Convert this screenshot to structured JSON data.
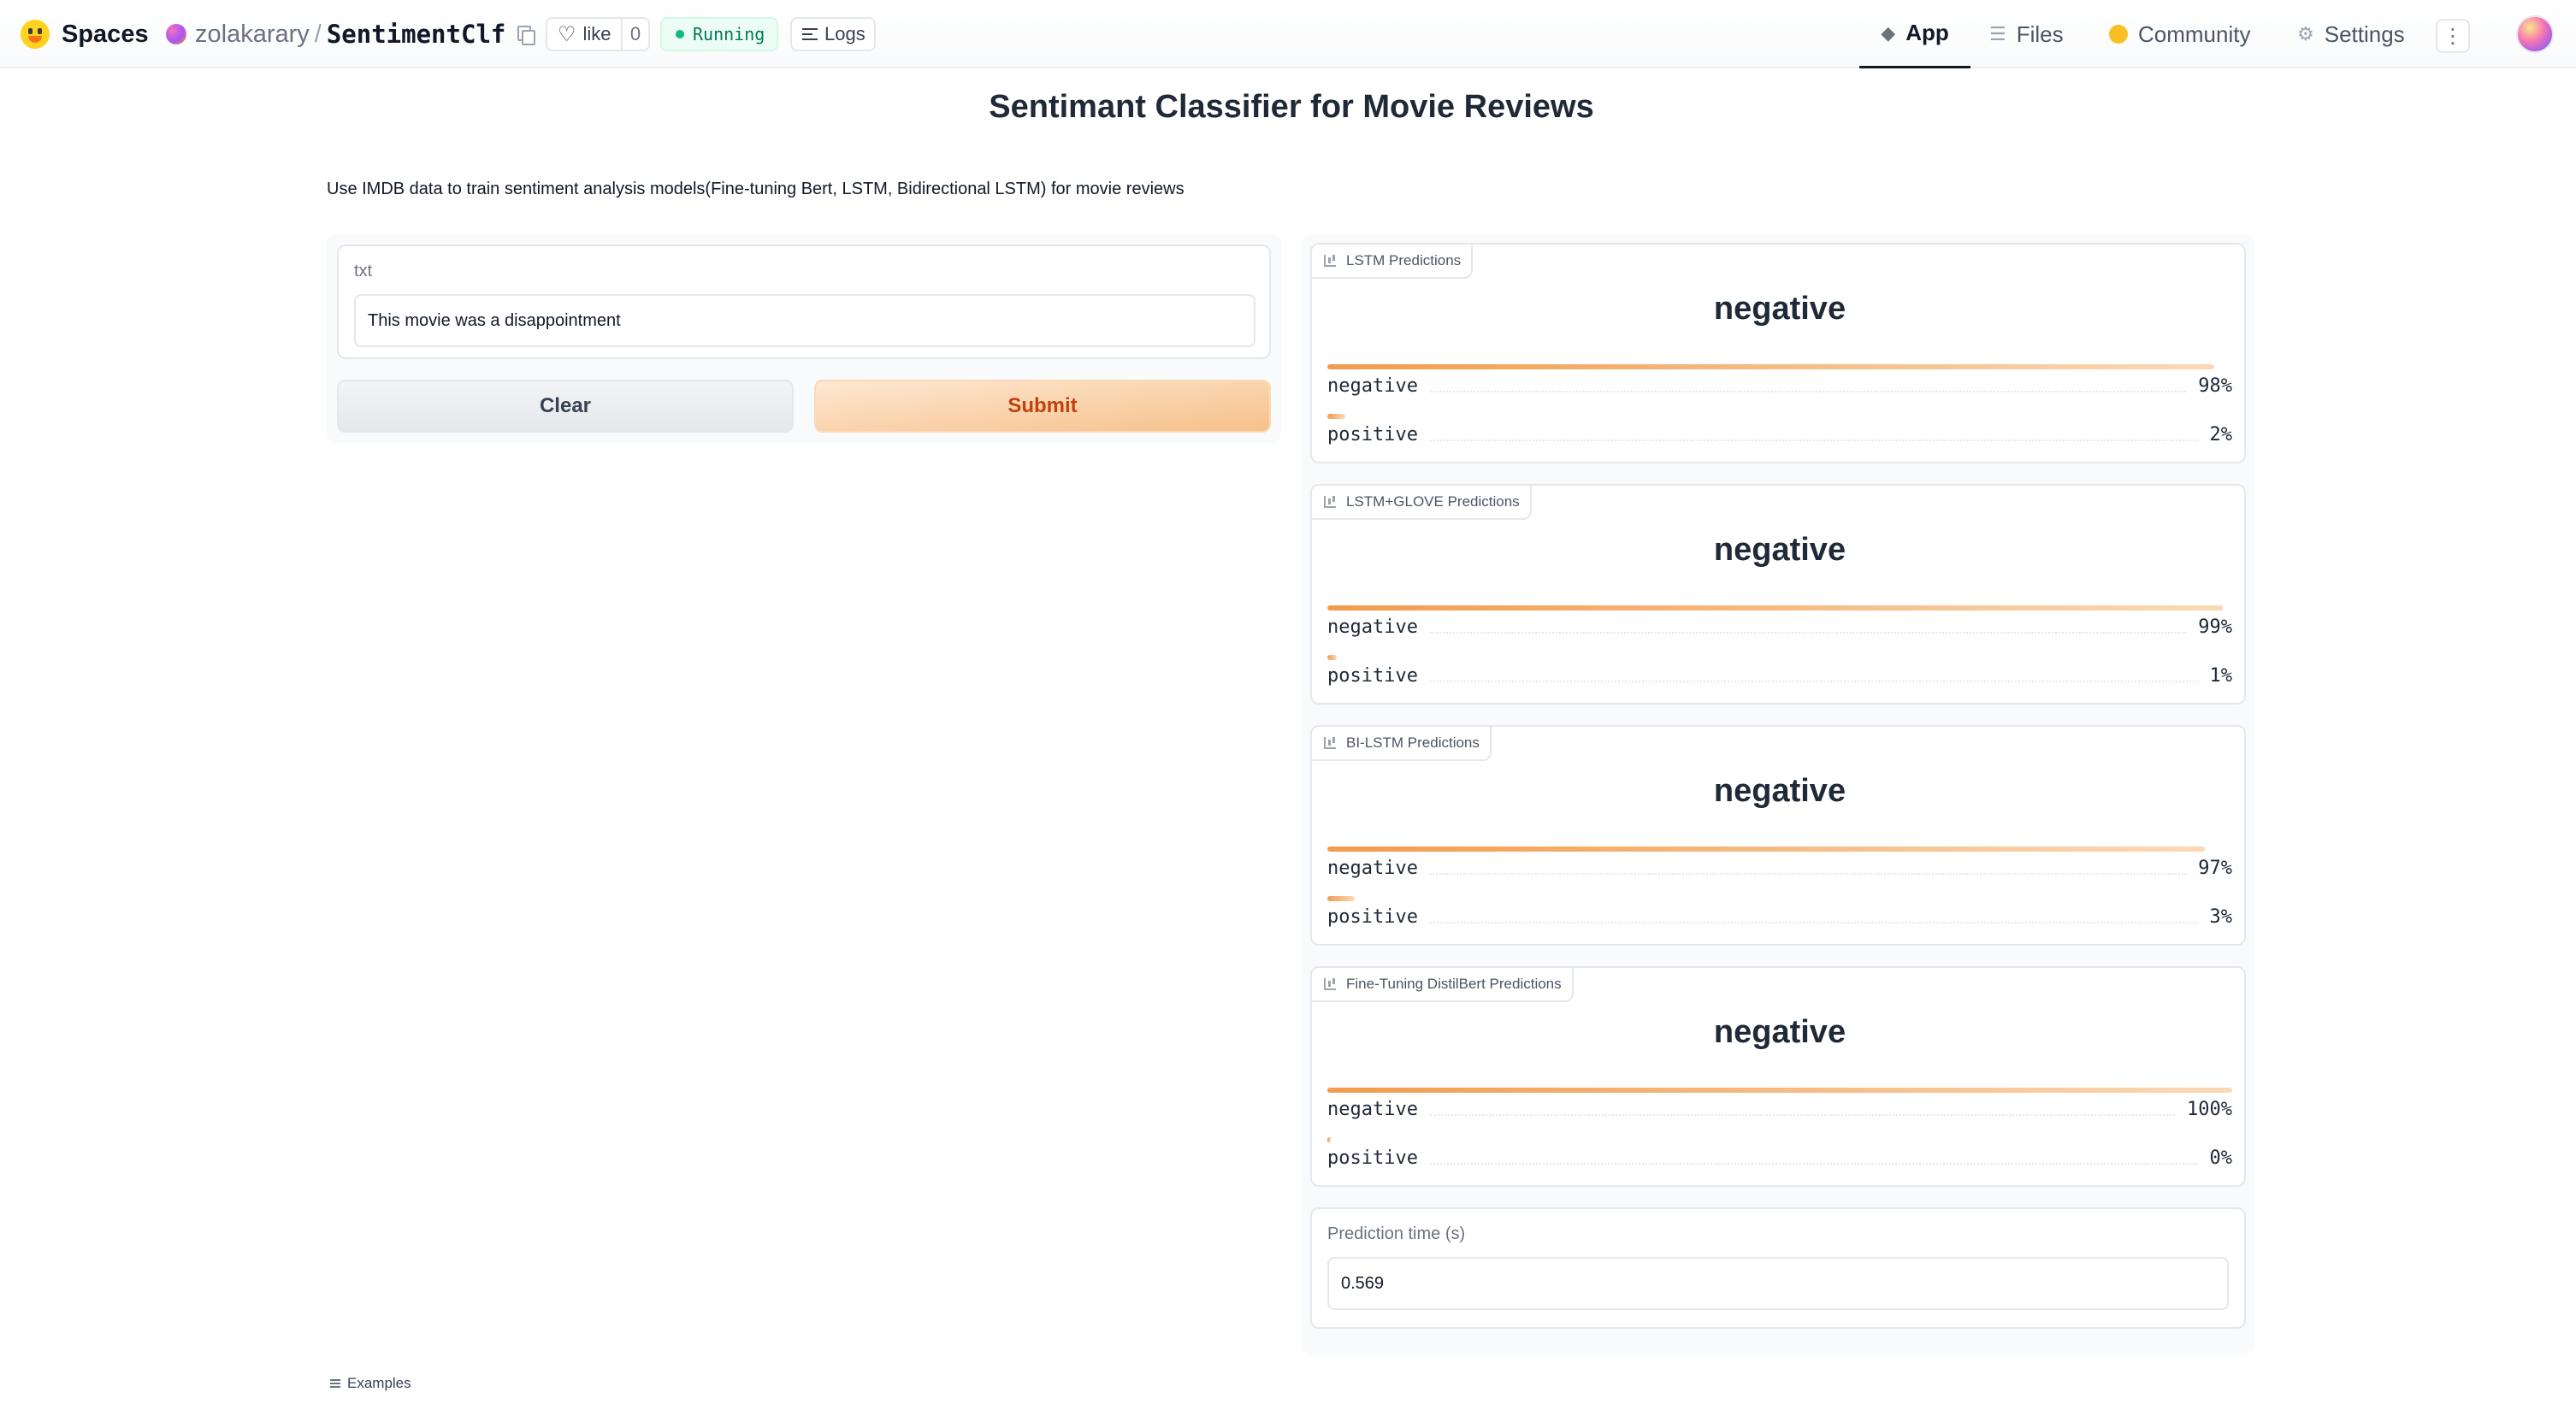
{
  "header": {
    "brand": "Spaces",
    "owner": "zolakarary",
    "separator": "/",
    "space_name": "SentimentClf",
    "like_label": "like",
    "like_count": "0",
    "status": "Running",
    "logs_label": "Logs",
    "nav": {
      "app": "App",
      "files": "Files",
      "community": "Community",
      "settings": "Settings"
    }
  },
  "main": {
    "title": "Sentimant Classifier for Movie Reviews",
    "description": "Use IMDB data to train sentiment analysis models(Fine-tuning Bert, LSTM, Bidirectional LSTM) for movie reviews",
    "input": {
      "label": "txt",
      "value": "This movie was a disappointment"
    },
    "buttons": {
      "clear": "Clear",
      "submit": "Submit"
    },
    "predictions": [
      {
        "title": "LSTM Predictions",
        "label": "negative",
        "rows": [
          {
            "name": "negative",
            "pct": "98%",
            "value": 0.98
          },
          {
            "name": "positive",
            "pct": "2%",
            "value": 0.02
          }
        ]
      },
      {
        "title": "LSTM+GLOVE Predictions",
        "label": "negative",
        "rows": [
          {
            "name": "negative",
            "pct": "99%",
            "value": 0.99
          },
          {
            "name": "positive",
            "pct": "1%",
            "value": 0.01
          }
        ]
      },
      {
        "title": "BI-LSTM Predictions",
        "label": "negative",
        "rows": [
          {
            "name": "negative",
            "pct": "97%",
            "value": 0.97
          },
          {
            "name": "positive",
            "pct": "3%",
            "value": 0.03
          }
        ]
      },
      {
        "title": "Fine-Tuning DistilBert Predictions",
        "label": "negative",
        "rows": [
          {
            "name": "negative",
            "pct": "100%",
            "value": 1.0
          },
          {
            "name": "positive",
            "pct": "0%",
            "value": 0.0
          }
        ]
      }
    ],
    "prediction_time": {
      "label": "Prediction time (s)",
      "value": "0.569"
    },
    "examples_label": "Examples"
  },
  "colors": {
    "accent": "#f29b4d",
    "submit_text": "#c2410c",
    "running": "#10b981"
  }
}
